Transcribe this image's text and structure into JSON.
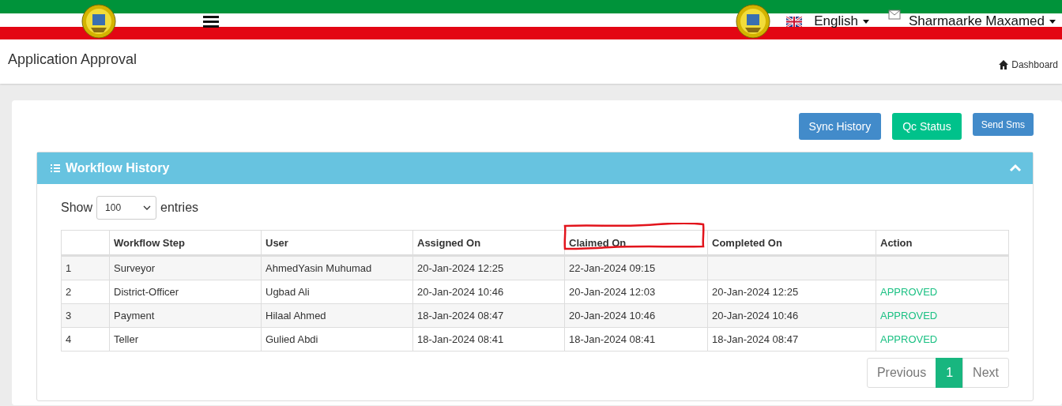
{
  "header": {
    "language": "English",
    "user": "Sharmaarke Maxamed"
  },
  "page": {
    "title": "Application Approval",
    "breadcrumb": "Dashboard"
  },
  "buttons": [
    {
      "label": "Sync History",
      "kind": "primary"
    },
    {
      "label": "Qc Status",
      "kind": "success"
    },
    {
      "label": "Send Sms",
      "kind": "primary-small"
    }
  ],
  "panel": {
    "title": "Workflow History",
    "expanded": true
  },
  "length_menu": {
    "before": "Show",
    "value": "100",
    "after": "entries"
  },
  "table": {
    "columns": [
      {
        "highlighted": false
      },
      {
        "label": "Workflow Step",
        "highlighted": false
      },
      {
        "label": "User",
        "highlighted": false
      },
      {
        "label": "Assigned On",
        "highlighted": false
      },
      {
        "label": "Claimed On",
        "highlighted": true
      },
      {
        "label": "Completed On",
        "highlighted": false
      },
      {
        "label": "Action",
        "highlighted": false
      }
    ],
    "rows": [
      {
        "cells": [
          "1",
          "Surveyor",
          "AhmedYasin Muhumad",
          "20-Jan-2024 12:25",
          "22-Jan-2024 09:15",
          null,
          null
        ]
      },
      {
        "cells": [
          "2",
          "District-Officer",
          "Ugbad Ali",
          "20-Jan-2024 10:46",
          "20-Jan-2024 12:03",
          "20-Jan-2024 12:25",
          "APPROVED"
        ]
      },
      {
        "cells": [
          "3",
          "Payment",
          "Hilaal Ahmed",
          "18-Jan-2024 08:47",
          "20-Jan-2024 10:46",
          "20-Jan-2024 10:46",
          "APPROVED"
        ]
      },
      {
        "cells": [
          "4",
          "Teller",
          "Gulied Abdi",
          "18-Jan-2024 08:41",
          "18-Jan-2024 08:41",
          "18-Jan-2024 08:47",
          "APPROVED"
        ]
      }
    ]
  },
  "pagination": [
    {
      "label": "Previous",
      "kind": "prev",
      "disabled": true
    },
    {
      "label": "1",
      "kind": "page",
      "selected": true
    },
    {
      "label": "Next",
      "kind": "next",
      "disabled": true
    }
  ]
}
